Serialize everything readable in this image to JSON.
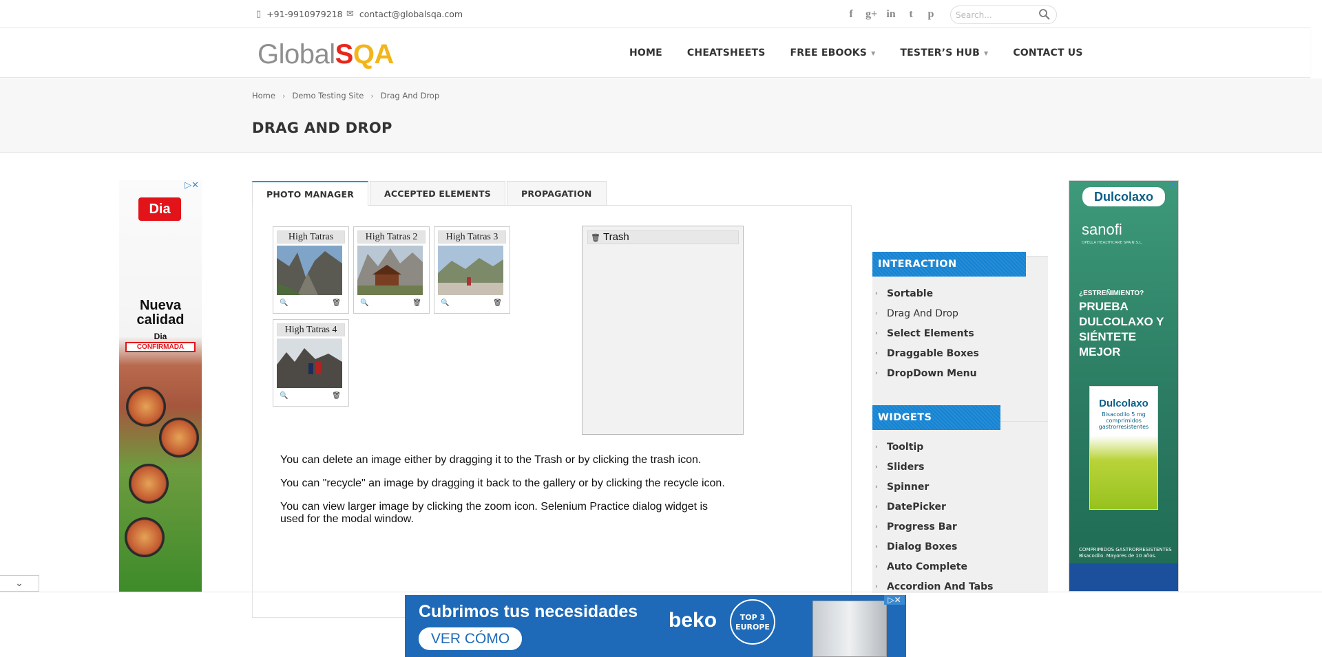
{
  "topbar": {
    "phone": "+91-9910979218",
    "email": "contact@globalsqa.com",
    "social": [
      "f",
      "g+",
      "in",
      "t",
      "p"
    ],
    "search_placeholder": "Search..."
  },
  "header": {
    "logo_part1": "Global",
    "logo_part2": "S",
    "logo_part3": "QA",
    "nav": [
      {
        "label": "HOME"
      },
      {
        "label": "CHEATSHEETS"
      },
      {
        "label": "FREE EBOOKS"
      },
      {
        "label": "TESTER’S HUB"
      },
      {
        "label": "CONTACT US"
      }
    ]
  },
  "breadcrumb": [
    "Home",
    "Demo Testing Site",
    "Drag And Drop"
  ],
  "page_title": "DRAG AND DROP",
  "tabs": [
    "PHOTO MANAGER",
    "ACCEPTED ELEMENTS",
    "PROPAGATION"
  ],
  "gallery": [
    {
      "title": "High Tatras"
    },
    {
      "title": "High Tatras 2"
    },
    {
      "title": "High Tatras 3"
    },
    {
      "title": "High Tatras 4"
    }
  ],
  "trash": {
    "title": "Trash"
  },
  "description": [
    "You can delete an image either by dragging it to the Trash or by clicking the trash icon.",
    "You can \"recycle\" an image by dragging it back to the gallery or by clicking the recycle icon.",
    "You can view larger image by clicking the zoom icon. Selenium Practice dialog widget is used for the modal window."
  ],
  "sidebar": {
    "interaction_title": "INTERACTION",
    "interaction_items": [
      "Sortable",
      "Drag And Drop",
      "Select Elements",
      "Draggable Boxes",
      "DropDown Menu"
    ],
    "widgets_title": "WIDGETS",
    "widgets_items": [
      "Tooltip",
      "Sliders",
      "Spinner",
      "DatePicker",
      "Progress Bar",
      "Dialog Boxes",
      "Auto Complete",
      "Accordion And Tabs"
    ]
  },
  "ads": {
    "left": {
      "brand": "Dia",
      "headline": "Nueva calidad",
      "brand2": "Dia",
      "badge": "CONFIRMADA"
    },
    "right": {
      "brand": "Dulcolaxo",
      "maker": "sanofi",
      "maker_sub": "OPELLA HEALTHCARE SPAIN S.L.",
      "question": "¿ESTREÑIMIENTO?",
      "claim": "PRUEBA DULCOLAXO Y SIÉNTETE MEJOR",
      "box_title": "Dulcolaxo",
      "box_sub": "Bisacodilo 5 mg comprimidos gastrorresistentes",
      "footer": "COMPRIMIDOS GASTRORRESISTENTES Bisacodilo. Mayores de 10 años."
    },
    "bottom": {
      "headline": "Cubrimos tus necesidades",
      "cta": "VER CÓMO",
      "brand": "beko",
      "badge": "TOP 3 EUROPE"
    }
  },
  "colors": {
    "accent": "#1e9ad6",
    "sidebar_header": "#1583d2",
    "logo_red": "#e8261c",
    "logo_yellow": "#f3b51b"
  }
}
